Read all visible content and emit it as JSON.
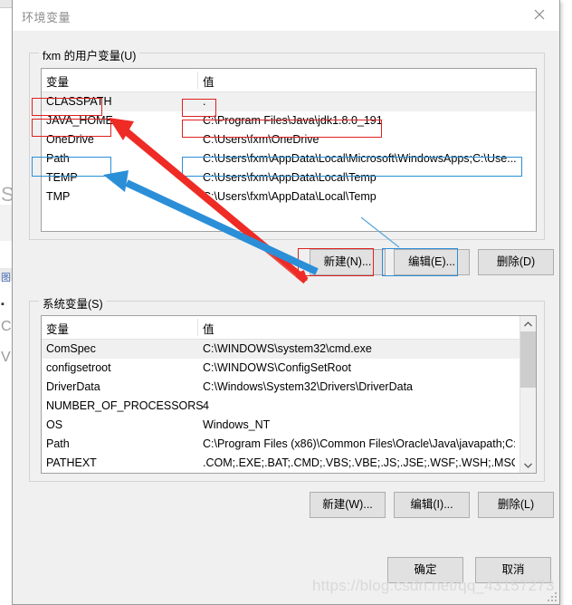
{
  "window": {
    "title": "环境变量",
    "close_icon": "close-icon"
  },
  "user_section": {
    "legend": "fxm 的用户变量(U)",
    "columns": [
      "变量",
      "值"
    ],
    "rows": [
      {
        "name": "CLASSPATH",
        "value": ".",
        "selected": true
      },
      {
        "name": "JAVA_HOME",
        "value": "C:\\Program Files\\Java\\jdk1.8.0_191",
        "selected": false
      },
      {
        "name": "OneDrive",
        "value": "C:\\Users\\fxm\\OneDrive",
        "selected": false
      },
      {
        "name": "Path",
        "value": "C:\\Users\\fxm\\AppData\\Local\\Microsoft\\WindowsApps;C:\\Use...",
        "selected": false
      },
      {
        "name": "TEMP",
        "value": "C:\\Users\\fxm\\AppData\\Local\\Temp",
        "selected": false
      },
      {
        "name": "TMP",
        "value": "C:\\Users\\fxm\\AppData\\Local\\Temp",
        "selected": false
      }
    ],
    "buttons": {
      "new": "新建(N)...",
      "edit": "编辑(E)...",
      "delete": "删除(D)"
    }
  },
  "system_section": {
    "legend": "系统变量(S)",
    "columns": [
      "变量",
      "值"
    ],
    "rows": [
      {
        "name": "ComSpec",
        "value": "C:\\WINDOWS\\system32\\cmd.exe",
        "selected": true
      },
      {
        "name": "configsetroot",
        "value": "C:\\WINDOWS\\ConfigSetRoot",
        "selected": false
      },
      {
        "name": "DriverData",
        "value": "C:\\Windows\\System32\\Drivers\\DriverData",
        "selected": false
      },
      {
        "name": "NUMBER_OF_PROCESSORS",
        "value": "4",
        "selected": false
      },
      {
        "name": "OS",
        "value": "Windows_NT",
        "selected": false
      },
      {
        "name": "Path",
        "value": "C:\\Program Files (x86)\\Common Files\\Oracle\\Java\\javapath;C:...",
        "selected": false
      },
      {
        "name": "PATHEXT",
        "value": ".COM;.EXE;.BAT;.CMD;.VBS;.VBE;.JS;.JSE;.WSF;.WSH;.MSC",
        "selected": false
      }
    ],
    "buttons": {
      "new": "新建(W)...",
      "edit": "编辑(I)...",
      "delete": "删除(L)"
    },
    "scrollbar": {
      "up_arrow": "chevron-up-icon",
      "down_arrow": "chevron-down-icon"
    }
  },
  "dialog_buttons": {
    "ok": "确定",
    "cancel": "取消"
  },
  "annotations": {
    "accent_red": "#e02020",
    "accent_blue": "#2b8fd8",
    "red_arrow_label": "red-arrow-new-button-to-java-home",
    "blue_arrow_label": "blue-arrow-edit-button-to-path"
  },
  "watermark": {
    "text": "https://blog.csdn.net/qq_43157273"
  }
}
